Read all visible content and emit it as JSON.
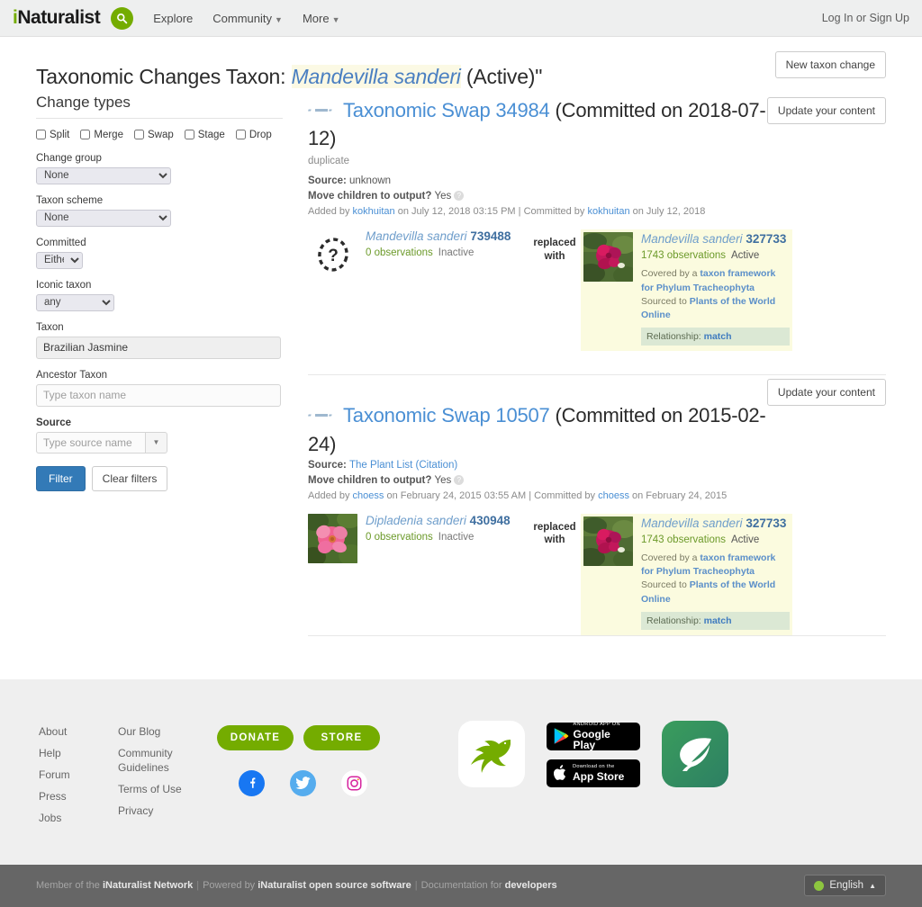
{
  "nav": {
    "brand_i": "i",
    "brand_rest": "Naturalist",
    "search_icon": "search-icon",
    "links": [
      {
        "label": "Explore",
        "caret": false
      },
      {
        "label": "Community",
        "caret": true
      },
      {
        "label": "More",
        "caret": true
      }
    ],
    "auth": "Log In or Sign Up"
  },
  "header": {
    "title_prefix": "Taxonomic Changes Taxon: ",
    "title_taxon": "Mandevilla sanderi",
    "title_suffix": " (Active)\"",
    "new_change_button": "New taxon change"
  },
  "sidebar": {
    "change_types_heading": "Change types",
    "change_types": [
      "Split",
      "Merge",
      "Swap",
      "Stage",
      "Drop"
    ],
    "change_group_label": "Change group",
    "change_group_value": "None",
    "taxon_scheme_label": "Taxon scheme",
    "taxon_scheme_value": "None",
    "committed_label": "Committed",
    "committed_value": "Either",
    "iconic_taxon_label": "Iconic taxon",
    "iconic_taxon_value": "any",
    "taxon_label": "Taxon",
    "taxon_value": "Brazilian Jasmine",
    "ancestor_label": "Ancestor Taxon",
    "ancestor_placeholder": "Type taxon name",
    "source_label": "Source",
    "source_placeholder": "Type source name",
    "filter_button": "Filter",
    "clear_button": "Clear filters"
  },
  "changes": [
    {
      "icon": "taxon-swap-icon",
      "link_text": "Taxonomic Swap 34984",
      "committed_text": " (Committed on 2018-07-12)",
      "note": "duplicate",
      "source_label": "Source: ",
      "source_value": "unknown",
      "source_is_link": false,
      "source_citation": "",
      "move_children_label": "Move children to output? ",
      "move_children_value": "Yes",
      "byline": {
        "added_by": "Added by ",
        "added_user": "kokhuitan",
        "added_when": " on July 12, 2018 03:15 PM",
        "divider": " | ",
        "committed_by": "Committed by ",
        "committed_user": "kokhuitan",
        "committed_when": " on July 12, 2018"
      },
      "update_button": "Update your content",
      "replaced_with": "replaced with",
      "input_taxon": {
        "thumb": "placeholder-question-icon",
        "name": "Mandevilla sanderi",
        "id": "739488",
        "observations": "0 observations",
        "state": "Inactive"
      },
      "output_taxon": {
        "thumb": "mandevilla-red-flower-photo",
        "name": "Mandevilla sanderi",
        "id": "327733",
        "observations": "1743 observations",
        "state": "Active",
        "framework_pre": "Covered by a ",
        "framework_link": "taxon framework for Phylum Tracheophyta",
        "framework_mid": " Sourced to ",
        "framework_source": "Plants of the World Online",
        "relationship_label": "Relationship: ",
        "relationship_value": "match"
      }
    },
    {
      "icon": "taxon-swap-icon",
      "link_text": "Taxonomic Swap 10507",
      "committed_text": " (Committed on 2015-02-24)",
      "note": "",
      "source_label": "Source: ",
      "source_value": "The Plant List",
      "source_is_link": true,
      "source_citation": " (Citation)",
      "move_children_label": "Move children to output? ",
      "move_children_value": "Yes",
      "byline": {
        "added_by": "Added by ",
        "added_user": "choess",
        "added_when": " on February 24, 2015 03:55 AM",
        "divider": " | ",
        "committed_by": "Committed by ",
        "committed_user": "choess",
        "committed_when": " on February 24, 2015"
      },
      "update_button": "Update your content",
      "replaced_with": "replaced with",
      "input_taxon": {
        "thumb": "dipladenia-pink-flower-photo",
        "name": "Dipladenia sanderi",
        "id": "430948",
        "observations": "0 observations",
        "state": "Inactive"
      },
      "output_taxon": {
        "thumb": "mandevilla-red-flower-photo",
        "name": "Mandevilla sanderi",
        "id": "327733",
        "observations": "1743 observations",
        "state": "Active",
        "framework_pre": "Covered by a ",
        "framework_link": "taxon framework for Phylum Tracheophyta",
        "framework_mid": " Sourced to ",
        "framework_source": "Plants of the World Online",
        "relationship_label": "Relationship: ",
        "relationship_value": "match"
      }
    }
  ],
  "footer": {
    "col1": [
      "About",
      "Help",
      "Forum",
      "Press",
      "Jobs"
    ],
    "col2": [
      "Our Blog",
      "Community Guidelines",
      "Terms of Use",
      "Privacy"
    ],
    "donate_button": "DONATE",
    "store_button": "STORE",
    "social": [
      "facebook-icon",
      "twitter-icon",
      "instagram-icon"
    ],
    "seek_icon": "seek-leaf-icon",
    "inat_bird_icon": "inaturalist-bird-icon",
    "google_play": {
      "small": "ANDROID APP ON",
      "big": "Google Play"
    },
    "app_store": {
      "small": "Download on the",
      "big": "App Store"
    },
    "bottom": {
      "member_pre": "Member of the ",
      "member_bold": "iNaturalist Network",
      "powered_pre": "Powered by ",
      "powered_bold": "iNaturalist open source software",
      "docs_pre": "Documentation for ",
      "docs_bold": "developers",
      "language": "English"
    }
  },
  "colors": {
    "brand_green": "#74ac00",
    "link_blue": "#4a8fd4",
    "primary_blue": "#337ab7",
    "highlight_yellow": "#fbfbdf",
    "relationship_green": "#dbe8d4"
  }
}
